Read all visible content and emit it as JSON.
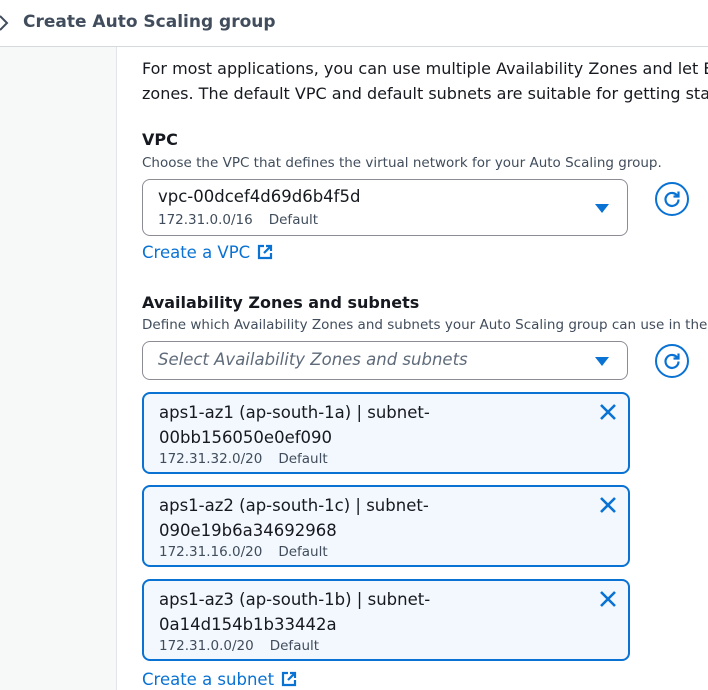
{
  "header": {
    "title": "Create Auto Scaling group"
  },
  "intro": {
    "line1": "For most applications, you can use multiple Availability Zones and let EC",
    "line2": "zones. The default VPC and default subnets are suitable for getting star"
  },
  "vpc": {
    "label": "VPC",
    "description": "Choose the VPC that defines the virtual network for your Auto Scaling group.",
    "selected_value": "vpc-00dcef4d69d6b4f5d",
    "cidr": "172.31.0.0/16",
    "tag": "Default",
    "create_link": "Create a VPC"
  },
  "subnets": {
    "label": "Availability Zones and subnets",
    "description": "Define which Availability Zones and subnets your Auto Scaling group can use in the",
    "placeholder": "Select Availability Zones and subnets",
    "tokens": [
      {
        "line1": "aps1-az1 (ap-south-1a) | subnet-",
        "line2": "00bb156050e0ef090",
        "cidr": "172.31.32.0/20",
        "tag": "Default"
      },
      {
        "line1": "aps1-az2 (ap-south-1c) | subnet-",
        "line2": "090e19b6a34692968",
        "cidr": "172.31.16.0/20",
        "tag": "Default"
      },
      {
        "line1": "aps1-az3 (ap-south-1b) | subnet-",
        "line2": "0a14d154b1b33442a",
        "cidr": "172.31.0.0/20",
        "tag": "Default"
      }
    ],
    "create_link": "Create a subnet"
  },
  "icons": {
    "header": "chevron-right-icon",
    "refresh": "refresh-icon",
    "dropdown": "caret-down-icon",
    "remove": "close-icon",
    "external": "external-link-icon"
  },
  "colors": {
    "accent": "#0972d3",
    "token_bg": "#f2f8fd",
    "text": "#16191f",
    "secondary": "#414d5c"
  }
}
